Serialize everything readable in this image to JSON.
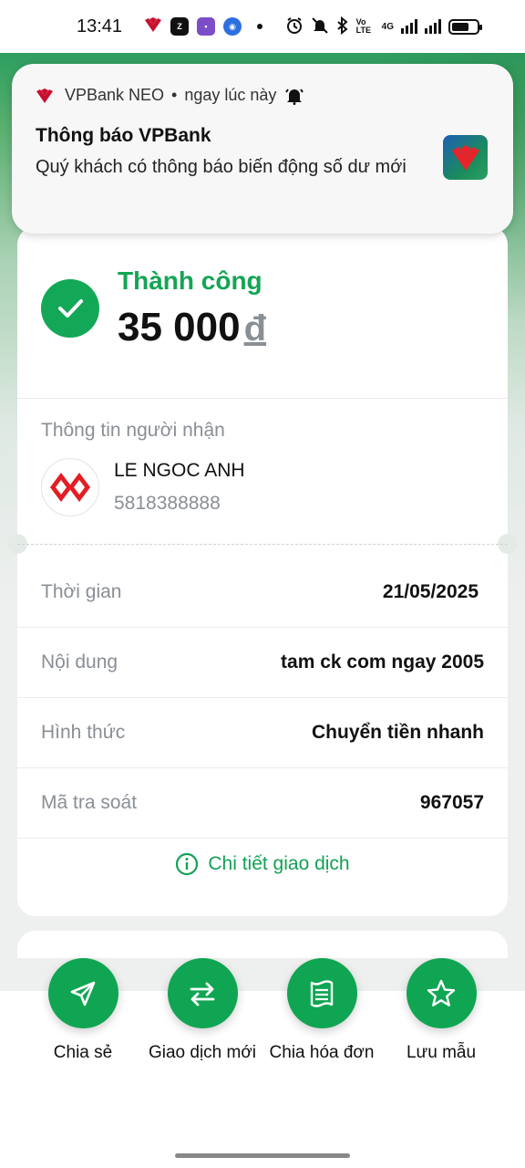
{
  "status_bar": {
    "time": "13:41",
    "network_label": "4G",
    "volte_label": "Vo LTE"
  },
  "notification": {
    "app_name": "VPBank NEO",
    "separator": "•",
    "time": "ngay lúc này",
    "title": "Thông báo VPBank",
    "body": "Quý khách có thông báo biến động số dư mới"
  },
  "result": {
    "status": "Thành công",
    "amount": "35 000",
    "currency": "đ"
  },
  "recipient": {
    "section_label": "Thông tin người nhận",
    "name": "LE NGOC ANH",
    "account": "5818388888"
  },
  "details": [
    {
      "label": "Thời gian",
      "value": "21/05/2025"
    },
    {
      "label": "Nội dung",
      "value": "tam ck com ngay 2005"
    },
    {
      "label": "Hình thức",
      "value": "Chuyển tiền nhanh"
    },
    {
      "label": "Mã tra soát",
      "value": "967057"
    }
  ],
  "detail_link": "Chi tiết giao dịch",
  "actions": [
    {
      "label": "Chia sẻ",
      "icon": "send-icon"
    },
    {
      "label": "Giao dịch mới",
      "icon": "swap-icon"
    },
    {
      "label": "Chia hóa đơn",
      "icon": "receipt-icon"
    },
    {
      "label": "Lưu mẫu",
      "icon": "star-icon"
    }
  ],
  "colors": {
    "accent_green": "#13a858",
    "brand_red": "#d91f26"
  }
}
